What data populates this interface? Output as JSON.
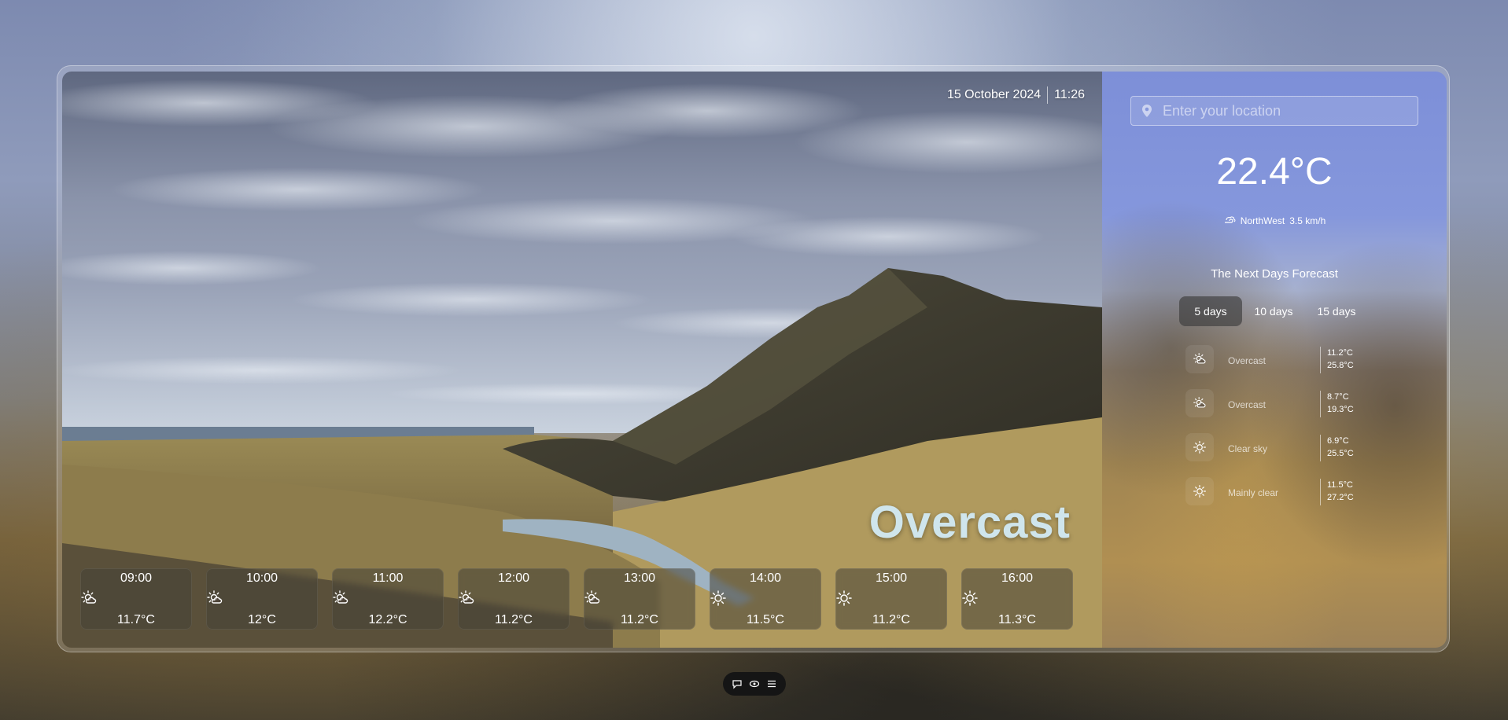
{
  "header": {
    "date": "15 October 2024",
    "time": "11:26"
  },
  "current": {
    "condition": "Overcast",
    "temperature": "22.4°C",
    "wind_direction": "NorthWest",
    "wind_speed": "3.5 km/h"
  },
  "search": {
    "placeholder": "Enter your location",
    "value": ""
  },
  "forecast": {
    "title": "The Next Days Forecast",
    "tabs": [
      {
        "label": "5 days",
        "active": true
      },
      {
        "label": "10 days",
        "active": false
      },
      {
        "label": "15 days",
        "active": false
      }
    ],
    "days": [
      {
        "icon": "partly-cloudy-icon",
        "condition": "Overcast",
        "low": "11.2°C",
        "high": "25.8°C"
      },
      {
        "icon": "partly-cloudy-icon",
        "condition": "Overcast",
        "low": "8.7°C",
        "high": "19.3°C"
      },
      {
        "icon": "sun-icon",
        "condition": "Clear sky",
        "low": "6.9°C",
        "high": "25.5°C"
      },
      {
        "icon": "sun-icon",
        "condition": "Mainly clear",
        "low": "11.5°C",
        "high": "27.2°C"
      }
    ]
  },
  "hourly": [
    {
      "time": "09:00",
      "icon": "partly-cloudy-icon",
      "temp": "11.7°C"
    },
    {
      "time": "10:00",
      "icon": "partly-cloudy-icon",
      "temp": "12°C"
    },
    {
      "time": "11:00",
      "icon": "partly-cloudy-icon",
      "temp": "12.2°C"
    },
    {
      "time": "12:00",
      "icon": "partly-cloudy-icon",
      "temp": "11.2°C"
    },
    {
      "time": "13:00",
      "icon": "partly-cloudy-icon",
      "temp": "11.2°C"
    },
    {
      "time": "14:00",
      "icon": "sun-icon",
      "temp": "11.5°C"
    },
    {
      "time": "15:00",
      "icon": "sun-icon",
      "temp": "11.2°C"
    },
    {
      "time": "16:00",
      "icon": "sun-icon",
      "temp": "11.3°C"
    }
  ],
  "dock": {
    "items": [
      "chat-icon",
      "eye-icon",
      "menu-icon"
    ]
  }
}
